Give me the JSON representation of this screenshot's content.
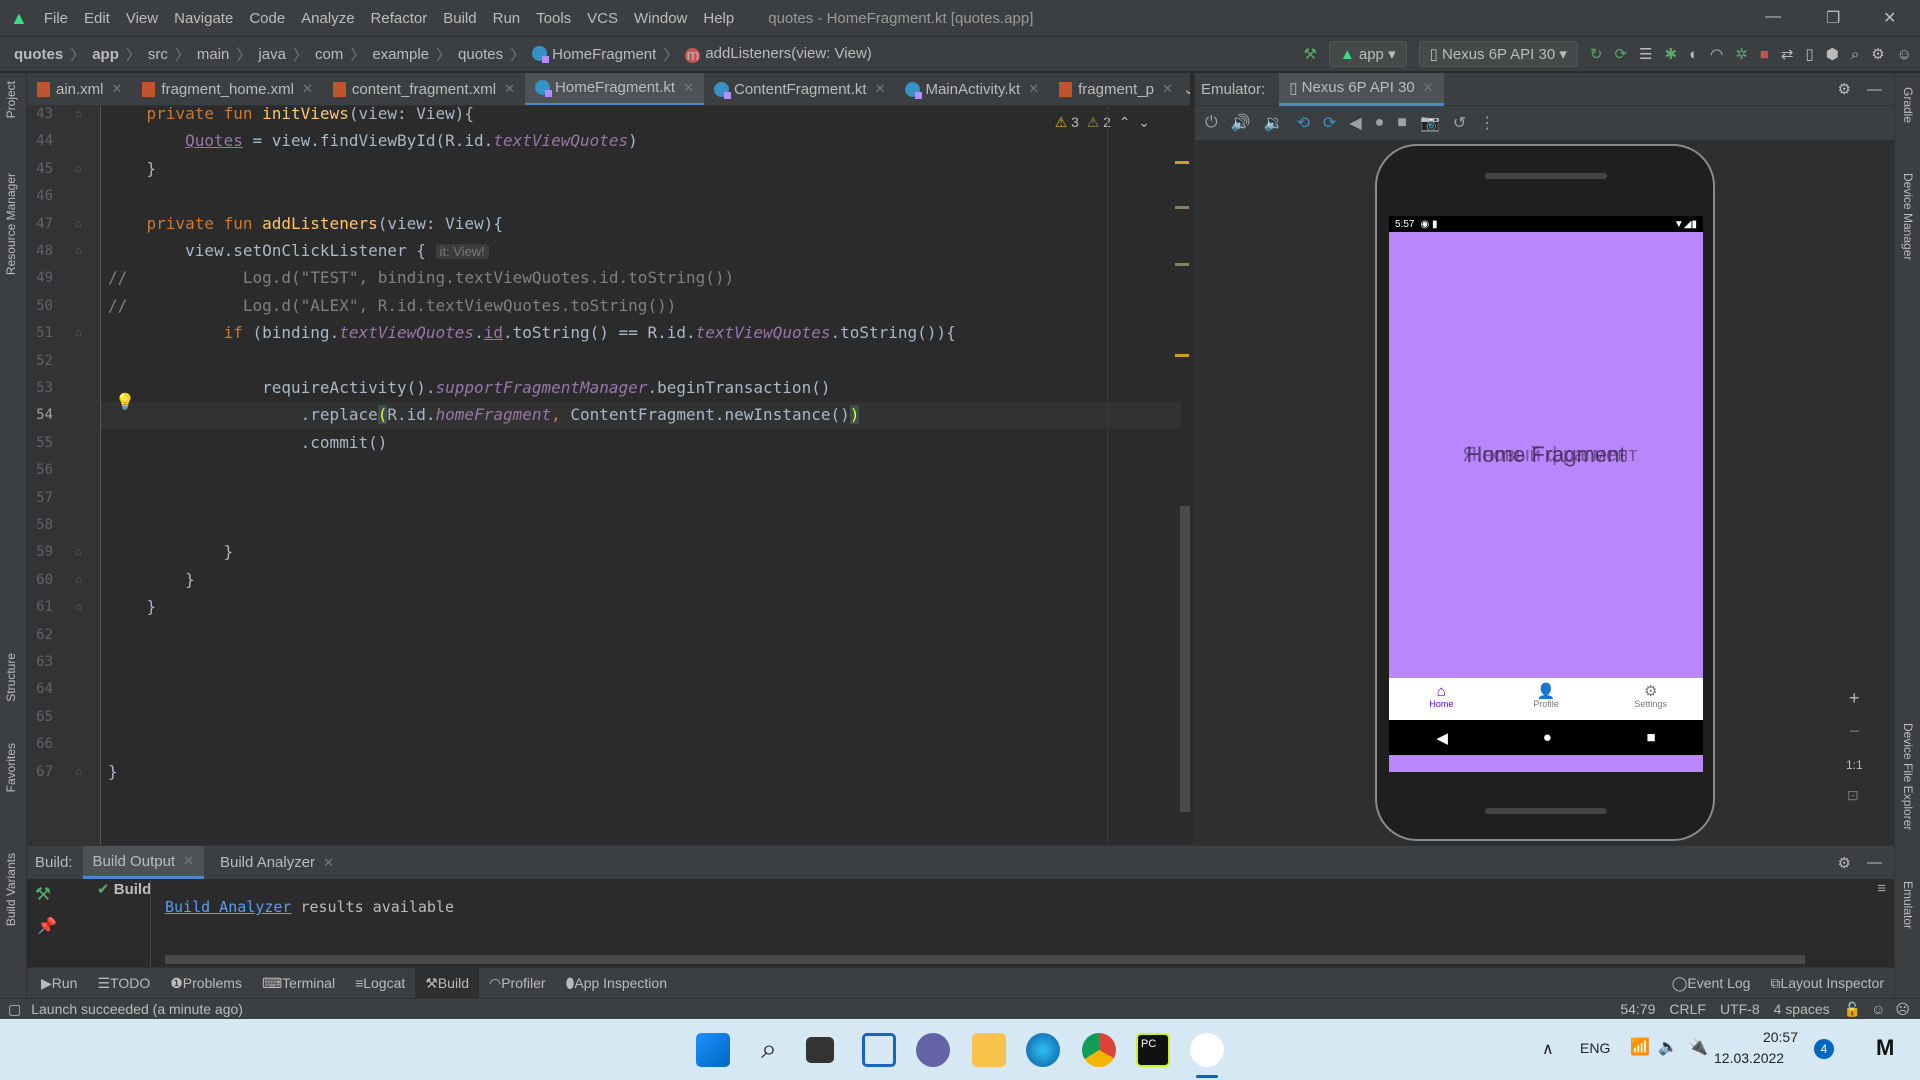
{
  "menu": [
    "File",
    "Edit",
    "View",
    "Navigate",
    "Code",
    "Analyze",
    "Refactor",
    "Build",
    "Run",
    "Tools",
    "VCS",
    "Window",
    "Help"
  ],
  "window_title": "quotes - HomeFragment.kt [quotes.app]",
  "breadcrumb": [
    "quotes",
    "app",
    "src",
    "main",
    "java",
    "com",
    "example",
    "quotes",
    "HomeFragment",
    "addListeners(view: View)"
  ],
  "toolbar": {
    "run_config": "app",
    "device": "Nexus 6P API 30"
  },
  "tabs": [
    {
      "label": "ain.xml",
      "type": "xml"
    },
    {
      "label": "fragment_home.xml",
      "type": "xml"
    },
    {
      "label": "content_fragment.xml",
      "type": "xml"
    },
    {
      "label": "HomeFragment.kt",
      "type": "kt",
      "active": true
    },
    {
      "label": "ContentFragment.kt",
      "type": "kt"
    },
    {
      "label": "MainActivity.kt",
      "type": "kt"
    },
    {
      "label": "fragment_p",
      "type": "xml"
    }
  ],
  "inspections": {
    "warnings": "3",
    "weak_warnings": "2"
  },
  "code": [
    {
      "n": 43,
      "t": [
        [
          "    ",
          ""
        ],
        [
          "private fun ",
          "kw"
        ],
        [
          "initViews",
          "fn"
        ],
        [
          "(view: View){",
          ""
        ]
      ]
    },
    {
      "n": 44,
      "t": [
        [
          "        ",
          ""
        ],
        [
          "Quotes",
          "ul"
        ],
        [
          " = view.findViewById(R.id.",
          ""
        ],
        [
          "textViewQuotes",
          "prop"
        ],
        [
          ")",
          ""
        ]
      ]
    },
    {
      "n": 45,
      "t": [
        [
          "    }",
          ""
        ]
      ]
    },
    {
      "n": 46,
      "t": []
    },
    {
      "n": 47,
      "t": [
        [
          "    ",
          ""
        ],
        [
          "private fun ",
          "kw"
        ],
        [
          "addListeners",
          "fn"
        ],
        [
          "(view: View){",
          ""
        ]
      ]
    },
    {
      "n": 48,
      "t": [
        [
          "        view.setOnClickListener { ",
          ""
        ],
        [
          "it: View!",
          "hint"
        ]
      ]
    },
    {
      "n": 49,
      "t": [
        [
          "//            Log.d(\"TEST\", binding.textViewQuotes.id.toString())",
          "cm"
        ]
      ]
    },
    {
      "n": 50,
      "t": [
        [
          "//            Log.d(\"ALEX\", R.id.textViewQuotes.toString())",
          "cm"
        ]
      ]
    },
    {
      "n": 51,
      "t": [
        [
          "            ",
          ""
        ],
        [
          "if ",
          "kw"
        ],
        [
          "(binding.",
          ""
        ],
        [
          "textViewQuotes",
          "prop"
        ],
        [
          ".",
          ""
        ],
        [
          "id",
          "ul"
        ],
        [
          ".toString() == R.id.",
          ""
        ],
        [
          "textViewQuotes",
          "prop"
        ],
        [
          ".toString()){",
          ""
        ]
      ]
    },
    {
      "n": 52,
      "t": []
    },
    {
      "n": 53,
      "t": [
        [
          "                requireActivity().",
          ""
        ],
        [
          "supportFragmentManager",
          "prop"
        ],
        [
          ".beginTransaction()",
          ""
        ]
      ]
    },
    {
      "n": 54,
      "t": [
        [
          "                    .replace",
          ""
        ],
        [
          "(",
          "brace"
        ],
        [
          "R.id.",
          ""
        ],
        [
          "homeFragment",
          "prop"
        ],
        [
          ", ",
          "kw"
        ],
        [
          "ContentFragment.newInstance()",
          ""
        ],
        [
          ")",
          "brace"
        ]
      ],
      "current": true
    },
    {
      "n": 55,
      "t": [
        [
          "                    .commit()",
          ""
        ]
      ]
    },
    {
      "n": 56,
      "t": []
    },
    {
      "n": 57,
      "t": []
    },
    {
      "n": 58,
      "t": []
    },
    {
      "n": 59,
      "t": [
        [
          "            }",
          ""
        ]
      ]
    },
    {
      "n": 60,
      "t": [
        [
          "        }",
          ""
        ]
      ]
    },
    {
      "n": 61,
      "t": [
        [
          "    }",
          ""
        ]
      ]
    },
    {
      "n": 62,
      "t": []
    },
    {
      "n": 63,
      "t": []
    },
    {
      "n": 64,
      "t": []
    },
    {
      "n": 65,
      "t": []
    },
    {
      "n": 66,
      "t": []
    },
    {
      "n": 67,
      "t": [
        [
          "}",
          ""
        ]
      ]
    }
  ],
  "emulator": {
    "label": "Emulator:",
    "tab": "Nexus 6P API 30",
    "phone": {
      "time": "5:57",
      "text_a": "Home Fragment",
      "text_b": "Я новый фрагмент",
      "nav": [
        {
          "label": "Home",
          "icon": "home-icon",
          "active": true
        },
        {
          "label": "Profile",
          "icon": "person-icon"
        },
        {
          "label": "Settings",
          "icon": "gear-icon"
        }
      ]
    },
    "zoom_reset": "1:1"
  },
  "left_strip": [
    "Project",
    "Resource Manager",
    "Structure",
    "Favorites",
    "Build Variants"
  ],
  "right_strip": [
    "Gradle",
    "Device Manager",
    "Device File Explorer",
    "Emulator"
  ],
  "build": {
    "label": "Build:",
    "tabs": [
      "Build Output",
      "Build Analyzer"
    ],
    "tree_item": "Build",
    "link": "Build Analyzer",
    "message": " results available"
  },
  "bottom_tabs": [
    "Run",
    "TODO",
    "Problems",
    "Terminal",
    "Logcat",
    "Build",
    "Profiler",
    "App Inspection"
  ],
  "bottom_right": [
    "Event Log",
    "Layout Inspector"
  ],
  "status": {
    "message": "Launch succeeded (a minute ago)",
    "position": "54:79",
    "line_sep": "CRLF",
    "encoding": "UTF-8",
    "indent": "4 spaces"
  },
  "taskbar": {
    "lang": "ENG",
    "time": "20:57",
    "date": "12.03.2022",
    "notifications": "4"
  },
  "colors": {
    "accent": "#4a88c7",
    "phone_bg": "#ba86fc",
    "nav_active": "#6200ee"
  }
}
